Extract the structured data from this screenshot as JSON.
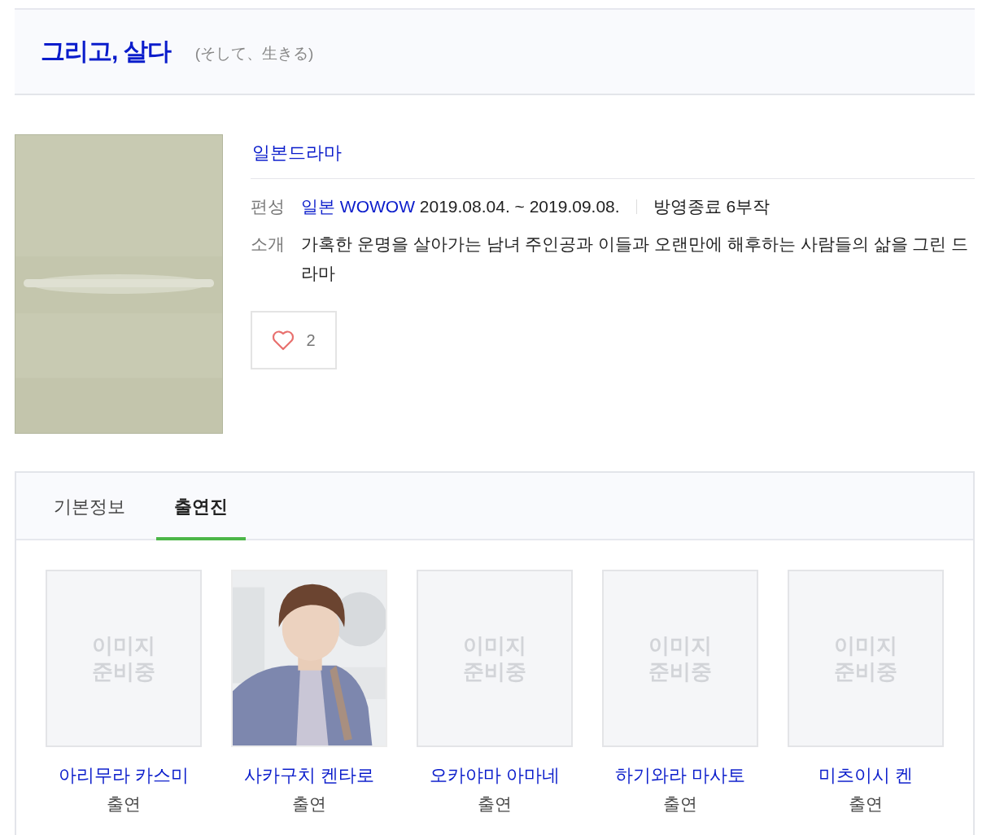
{
  "header": {
    "title": "그리고, 살다",
    "subtitle": "(そして、生きる)"
  },
  "genre": "일본드라마",
  "info": [
    {
      "kind": "broadcast",
      "label": "편성",
      "network": "일본 WOWOW",
      "period": "2019.08.04. ~ 2019.09.08.",
      "status": "방영종료 6부작"
    },
    {
      "kind": "synopsis",
      "label": "소개",
      "text": "가혹한 운명을 살아가는 남녀 주인공과 이들과 오랜만에 해후하는 사람들의 삶을 그린 드라마"
    }
  ],
  "like": {
    "count": "2"
  },
  "tabs": [
    {
      "label": "기본정보",
      "selected": false
    },
    {
      "label": "출연진",
      "selected": true
    }
  ],
  "cast": [
    {
      "name": "아리무라 카스미",
      "role": "출연",
      "image": {
        "kind": "placeholder",
        "lines": [
          "이미지",
          "준비중"
        ]
      }
    },
    {
      "name": "사카구치 켄타로",
      "role": "출연"
    },
    {
      "name": "오카야마 아마네",
      "role": "출연",
      "image": {
        "kind": "placeholder",
        "lines": [
          "이미지",
          "준비중"
        ]
      }
    },
    {
      "name": "하기와라 마사토",
      "role": "출연",
      "image": {
        "kind": "placeholder",
        "lines": [
          "이미지",
          "준비중"
        ]
      }
    },
    {
      "name": "미츠이시 켄",
      "role": "출연",
      "image": {
        "kind": "placeholder",
        "lines": [
          "이미지",
          "준비중"
        ]
      }
    }
  ]
}
